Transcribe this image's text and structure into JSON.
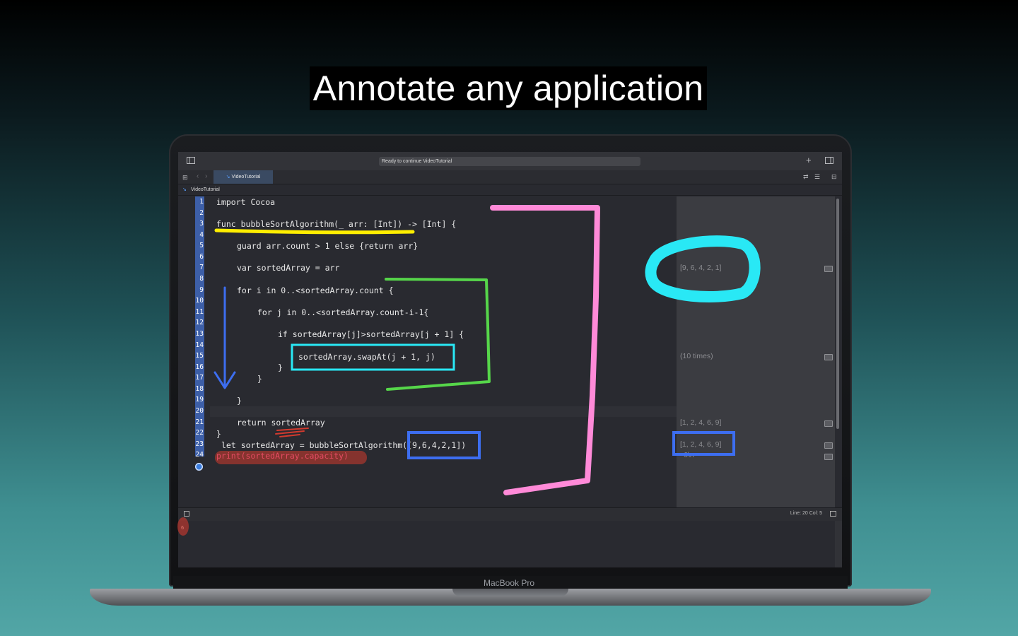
{
  "headline": "Annotate any application",
  "device": {
    "label": "MacBook Pro"
  },
  "xcode": {
    "status": "Ready to continue VideoTutorial",
    "tab": "VideoTutorial",
    "breadcrumb": "VideoTutorial",
    "line_numbers": [
      "1",
      "2",
      "3",
      "4",
      "5",
      "6",
      "7",
      "8",
      "9",
      "10",
      "11",
      "12",
      "13",
      "14",
      "15",
      "16",
      "17",
      "18",
      "19",
      "20",
      "21",
      "22",
      "23",
      "24"
    ],
    "code_lines": [
      "import Cocoa",
      "func bubbleSortAlgorithm(_ arr: [Int]) -> [Int] {",
      "guard arr.count > 1 else {return arr}",
      "var sortedArray = arr",
      "for i in 0..<sortedArray.count {",
      "for j in 0..<sortedArray.count-i-1{",
      "if sortedArray[j]>sortedArray[j + 1] {",
      "sortedArray.swapAt(j + 1, j)",
      "}",
      "}",
      "}",
      "return sortedArray",
      "}",
      "let sortedArray = bubbleSortAlgorithm([9,6,4,2,1])",
      "print(sortedArray.capacity)"
    ],
    "results": [
      "[9, 6, 4, 2, 1]",
      "(10 times)",
      "[1, 2, 4, 6, 9]",
      "[1, 2, 4, 6, 9]",
      "6\\n"
    ],
    "status_line": "Line: 20  Col: 5",
    "console_output": "6"
  },
  "annotation_colors": {
    "pink": "#ff8ad8",
    "cyan": "#29e8f5",
    "green": "#56d64a",
    "yellow": "#ffee00",
    "blue": "#3d6ef0",
    "red": "#d23a2e"
  }
}
